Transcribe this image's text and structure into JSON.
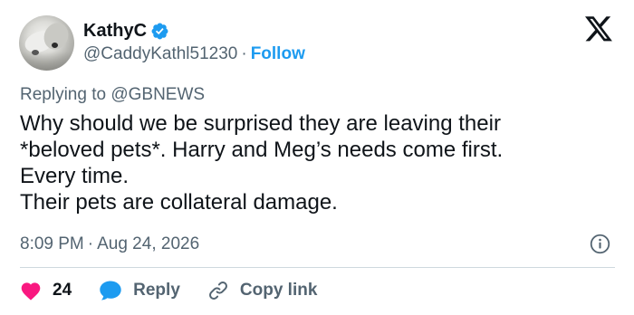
{
  "author": {
    "name": "KathyC",
    "handle": "@CaddyKathl51230",
    "separator": "·",
    "follow_label": "Follow",
    "verified": true,
    "avatar_icon": "cat-avatar-icon"
  },
  "platform": {
    "logo_icon": "x-logo-icon"
  },
  "reply_context": {
    "prefix": "Replying to",
    "mention": "@GBNEWS"
  },
  "tweet": {
    "lines": [
      "Why should we be surprised they are leaving their",
      "*beloved pets*. Harry and Meg’s needs come first.",
      "Every time.",
      "Their pets are collateral damage."
    ],
    "time": "8:09 PM",
    "separator": "·",
    "date": "Aug 24, 2026"
  },
  "actions": {
    "like_count": "24",
    "reply_label": "Reply",
    "copy_label": "Copy link"
  },
  "colors": {
    "accent": "#1d9bf0",
    "like": "#f91880",
    "muted": "#536471",
    "text": "#0f1419",
    "divider": "#cfd9de"
  }
}
